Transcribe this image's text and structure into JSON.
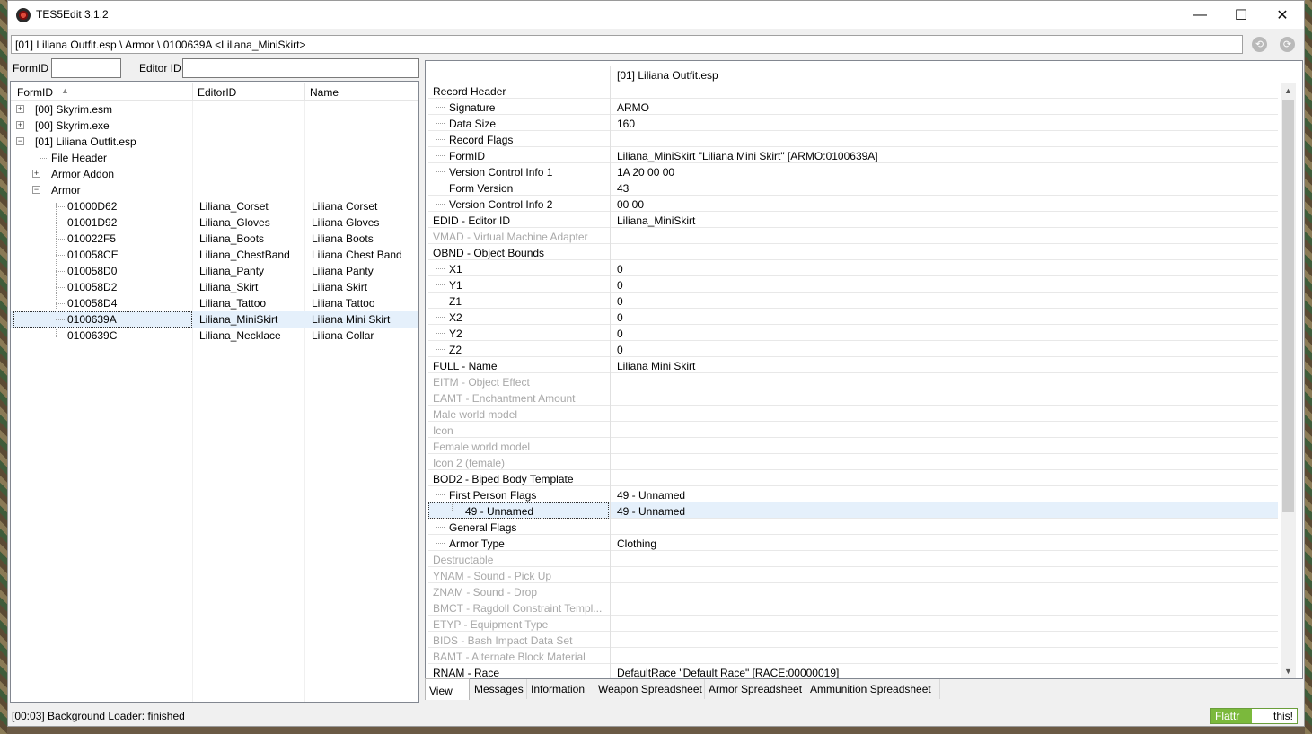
{
  "window": {
    "title": "TES5Edit 3.1.2"
  },
  "path": "[01] Liliana Outfit.esp \\ Armor \\ 0100639A <Liliana_MiniSkirt>",
  "filters": {
    "formid_label": "FormID",
    "editorid_label": "Editor ID",
    "formid_value": "",
    "editorid_value": ""
  },
  "tree": {
    "headers": {
      "formid": "FormID",
      "editorid": "EditorID",
      "name": "Name"
    },
    "roots": [
      "[00] Skyrim.esm",
      "[00] Skyrim.exe",
      "[01] Liliana Outfit.esp"
    ],
    "children": [
      "File Header",
      "Armor Addon",
      "Armor"
    ],
    "records": [
      {
        "formid": "01000D62",
        "editorid": "Liliana_Corset",
        "name": "Liliana Corset"
      },
      {
        "formid": "01001D92",
        "editorid": "Liliana_Gloves",
        "name": "Liliana Gloves"
      },
      {
        "formid": "010022F5",
        "editorid": "Liliana_Boots",
        "name": "Liliana Boots"
      },
      {
        "formid": "010058CE",
        "editorid": "Liliana_ChestBand",
        "name": "Liliana Chest Band"
      },
      {
        "formid": "010058D0",
        "editorid": "Liliana_Panty",
        "name": "Liliana Panty"
      },
      {
        "formid": "010058D2",
        "editorid": "Liliana_Skirt",
        "name": "Liliana Skirt"
      },
      {
        "formid": "010058D4",
        "editorid": "Liliana_Tattoo",
        "name": "Liliana Tattoo"
      },
      {
        "formid": "0100639A",
        "editorid": "Liliana_MiniSkirt",
        "name": "Liliana Mini Skirt"
      },
      {
        "formid": "0100639C",
        "editorid": "Liliana_Necklace",
        "name": "Liliana Collar"
      }
    ]
  },
  "view": {
    "header_value": "[01] Liliana Outfit.esp",
    "rows": [
      {
        "label": "Record Header",
        "value": "",
        "level": 0
      },
      {
        "label": "Signature",
        "value": "ARMO",
        "level": 1
      },
      {
        "label": "Data Size",
        "value": "160",
        "level": 1
      },
      {
        "label": "Record Flags",
        "value": "",
        "level": 1
      },
      {
        "label": "FormID",
        "value": "Liliana_MiniSkirt \"Liliana Mini Skirt\" [ARMO:0100639A]",
        "level": 1
      },
      {
        "label": "Version Control Info 1",
        "value": "1A 20 00 00",
        "level": 1
      },
      {
        "label": "Form Version",
        "value": "43",
        "level": 1
      },
      {
        "label": "Version Control Info 2",
        "value": "00 00",
        "level": 1
      },
      {
        "label": "EDID - Editor ID",
        "value": "Liliana_MiniSkirt",
        "level": 0
      },
      {
        "label": "VMAD - Virtual Machine Adapter",
        "value": "",
        "level": 0,
        "disabled": true
      },
      {
        "label": "OBND - Object Bounds",
        "value": "",
        "level": 0
      },
      {
        "label": "X1",
        "value": "0",
        "level": 1
      },
      {
        "label": "Y1",
        "value": "0",
        "level": 1
      },
      {
        "label": "Z1",
        "value": "0",
        "level": 1
      },
      {
        "label": "X2",
        "value": "0",
        "level": 1
      },
      {
        "label": "Y2",
        "value": "0",
        "level": 1
      },
      {
        "label": "Z2",
        "value": "0",
        "level": 1
      },
      {
        "label": "FULL - Name",
        "value": "Liliana Mini Skirt",
        "level": 0
      },
      {
        "label": "EITM - Object Effect",
        "value": "",
        "level": 0,
        "disabled": true
      },
      {
        "label": "EAMT - Enchantment Amount",
        "value": "",
        "level": 0,
        "disabled": true
      },
      {
        "label": "Male world model",
        "value": "",
        "level": 0,
        "disabled": true
      },
      {
        "label": "Icon",
        "value": "",
        "level": 0,
        "disabled": true
      },
      {
        "label": "Female world model",
        "value": "",
        "level": 0,
        "disabled": true
      },
      {
        "label": "Icon 2 (female)",
        "value": "",
        "level": 0,
        "disabled": true
      },
      {
        "label": "BOD2 - Biped Body Template",
        "value": "",
        "level": 0
      },
      {
        "label": "First Person Flags",
        "value": "49 - Unnamed",
        "level": 1
      },
      {
        "label": "49 - Unnamed",
        "value": "49 - Unnamed",
        "level": 2,
        "selected": true
      },
      {
        "label": "General Flags",
        "value": "",
        "level": 1
      },
      {
        "label": "Armor Type",
        "value": "Clothing",
        "level": 1
      },
      {
        "label": "Destructable",
        "value": "",
        "level": 0,
        "disabled": true
      },
      {
        "label": "YNAM - Sound - Pick Up",
        "value": "",
        "level": 0,
        "disabled": true
      },
      {
        "label": "ZNAM - Sound - Drop",
        "value": "",
        "level": 0,
        "disabled": true
      },
      {
        "label": "BMCT - Ragdoll Constraint Templ...",
        "value": "",
        "level": 0,
        "disabled": true
      },
      {
        "label": "ETYP - Equipment Type",
        "value": "",
        "level": 0,
        "disabled": true
      },
      {
        "label": "BIDS - Bash Impact Data Set",
        "value": "",
        "level": 0,
        "disabled": true
      },
      {
        "label": "BAMT - Alternate Block Material",
        "value": "",
        "level": 0,
        "disabled": true
      },
      {
        "label": "RNAM - Race",
        "value": "DefaultRace \"Default Race\" [RACE:00000019]",
        "level": 0
      }
    ]
  },
  "tabs": [
    "View",
    "Messages",
    "Information",
    "Weapon Spreadsheet",
    "Armor Spreadsheet",
    "Ammunition Spreadsheet"
  ],
  "status": "[00:03] Background Loader: finished",
  "flattr": {
    "left": "Flattr",
    "right": "this!"
  }
}
